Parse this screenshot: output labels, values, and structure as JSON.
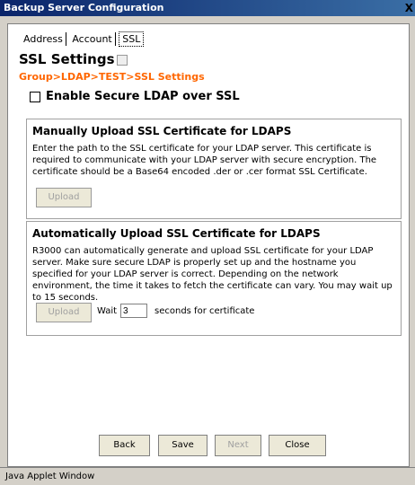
{
  "window": {
    "title": "Backup Server Configuration",
    "close_label": "X"
  },
  "tabs": {
    "items": [
      "Address",
      "Account",
      "SSL"
    ]
  },
  "page": {
    "title": "SSL Settings",
    "breadcrumb": "Group>LDAP>TEST>SSL Settings"
  },
  "enable_ssl": {
    "label": "Enable Secure LDAP over SSL",
    "checked": false
  },
  "manual": {
    "title": "Manually Upload SSL Certificate for LDAPS",
    "text": "Enter the path to the SSL certificate for your LDAP server. This certificate is required to communicate with your LDAP server with secure encryption. The certificate should be a Base64 encoded .der or .cer format SSL Certificate.",
    "upload_label": "Upload"
  },
  "auto": {
    "title": "Automatically Upload SSL Certificate for LDAPS",
    "text": "R3000 can automatically generate and upload SSL certificate for your LDAP server. Make sure secure LDAP is properly set up and the hostname you specified for your LDAP server is correct. Depending on the network environment, the time it takes to fetch the certificate can vary. You may wait up to 15 seconds.",
    "upload_label": "Upload",
    "wait_label": "Wait",
    "wait_value": "3",
    "wait_suffix": "seconds for certificate"
  },
  "footer": {
    "back_label": "Back",
    "save_label": "Save",
    "next_label": "Next",
    "close_label": "Close"
  },
  "status": {
    "text": "Java Applet Window"
  }
}
